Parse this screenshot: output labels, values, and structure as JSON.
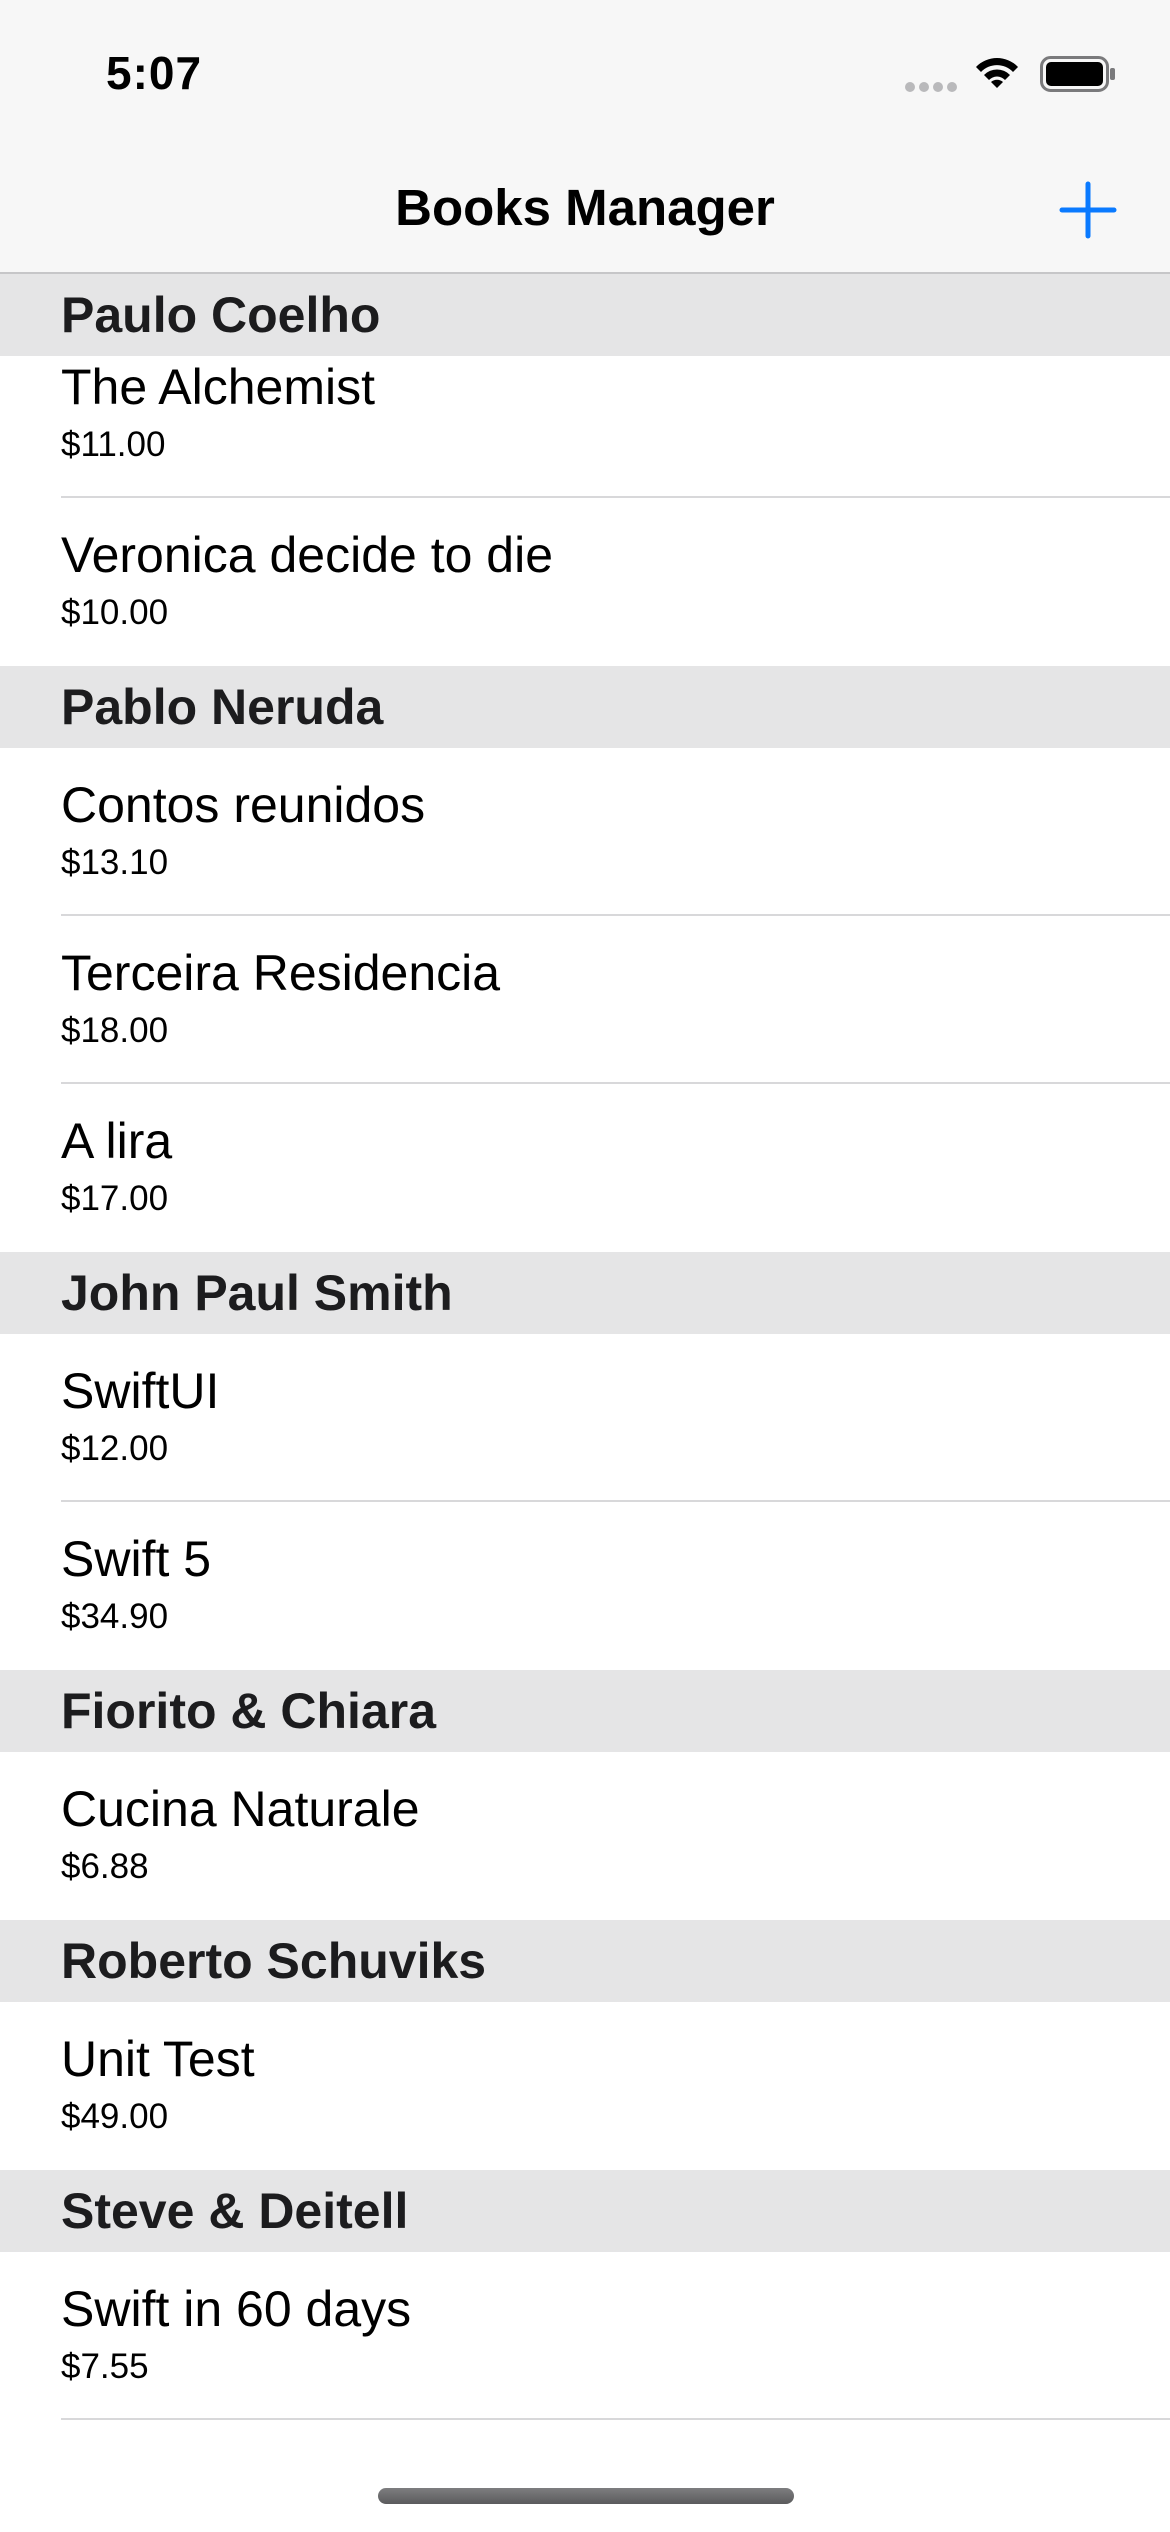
{
  "status_bar": {
    "time": "5:07",
    "icons": [
      "cellular-signal-icon",
      "wifi-icon",
      "battery-icon"
    ]
  },
  "nav": {
    "title": "Books Manager",
    "add_icon": "plus-icon",
    "accent_color": "#0a7aff"
  },
  "sections": [
    {
      "author": "Paulo Coelho",
      "books": [
        {
          "title": "The Alchemist",
          "price": "$11.00"
        },
        {
          "title": "Veronica decide to die",
          "price": "$10.00"
        }
      ]
    },
    {
      "author": "Pablo Neruda",
      "books": [
        {
          "title": "Contos reunidos",
          "price": "$13.10"
        },
        {
          "title": "Terceira Residencia",
          "price": "$18.00"
        },
        {
          "title": "A lira",
          "price": "$17.00"
        }
      ]
    },
    {
      "author": "John Paul Smith",
      "books": [
        {
          "title": "SwiftUI",
          "price": "$12.00"
        },
        {
          "title": "Swift 5",
          "price": "$34.90"
        }
      ]
    },
    {
      "author": "Fiorito & Chiara",
      "books": [
        {
          "title": "Cucina Naturale",
          "price": "$6.88"
        }
      ]
    },
    {
      "author": "Roberto Schuviks",
      "books": [
        {
          "title": "Unit Test",
          "price": "$49.00"
        }
      ]
    },
    {
      "author": "Steve & Deitell",
      "books": [
        {
          "title": "Swift in 60 days",
          "price": "$7.55"
        }
      ]
    }
  ],
  "colors": {
    "bar_background": "#f7f7f7",
    "section_header_background": "#e5e5e6",
    "separator": "#d8d8da"
  }
}
